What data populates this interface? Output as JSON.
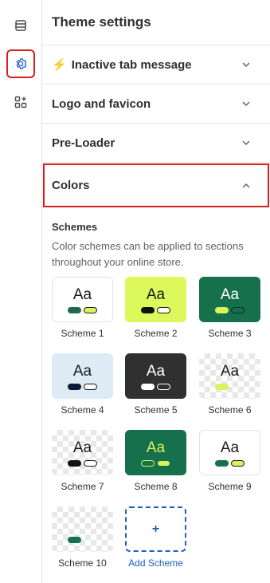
{
  "rail": {
    "items": [
      {
        "name": "sections-icon"
      },
      {
        "name": "theme-settings-icon",
        "active": true
      },
      {
        "name": "app-embeds-icon"
      }
    ],
    "accent": "#1f5fbf",
    "highlight": "#d61f1f"
  },
  "panel": {
    "title": "Theme settings",
    "accordions": [
      {
        "emoji": "⚡",
        "label": "Inactive tab message",
        "state": "collapsed"
      },
      {
        "label": "Logo and favicon",
        "state": "collapsed"
      },
      {
        "label": "Pre-Loader",
        "state": "collapsed"
      },
      {
        "label": "Colors",
        "state": "expanded"
      }
    ],
    "colors": {
      "schemes_heading": "Schemes",
      "description": "Color schemes can be applied to sections throughout your online store.",
      "schemes": [
        {
          "label": "Scheme 1",
          "text": "Aa",
          "bg": "#ffffff",
          "fg": "#1a1a1a",
          "pill1": "#1b6b4b",
          "pill2": "#d7f55a",
          "border": "#e3e3e3"
        },
        {
          "label": "Scheme 2",
          "text": "Aa",
          "bg": "#dcf85a",
          "fg": "#1a1a1a",
          "pill1": "#111111",
          "pill2": "#ffffff"
        },
        {
          "label": "Scheme 3",
          "text": "Aa",
          "bg": "#17704c",
          "fg": "#ffffff",
          "pill1": "#d7f55a",
          "pill2": "#17704c"
        },
        {
          "label": "Scheme 4",
          "text": "Aa",
          "bg": "#deebf5",
          "fg": "#1a1a1a",
          "pill1": "#0b1a3a",
          "pill2": "#ffffff"
        },
        {
          "label": "Scheme 5",
          "text": "Aa",
          "bg": "#303030",
          "fg": "#ffffff",
          "pill1": "#ffffff",
          "pill2": "#303030"
        },
        {
          "label": "Scheme 6",
          "text": "Aa",
          "bg": "checker",
          "fg": "#1a1a1a",
          "pill1": "#d7f55a",
          "pill2": null
        },
        {
          "label": "Scheme 7",
          "text": "Aa",
          "bg": "checker",
          "fg": "#1a1a1a",
          "pill1": "#111111",
          "pill2": "#ffffff"
        },
        {
          "label": "Scheme 8",
          "text": "Aa",
          "bg": "#17704c",
          "fg": "#d7f55a",
          "pill1": "#17704c",
          "pill2": "#d7f55a"
        },
        {
          "label": "Scheme 9",
          "text": "Aa",
          "bg": "#ffffff",
          "fg": "#1a1a1a",
          "pill1": "#17704c",
          "pill2": "#d7f55a",
          "border": "#e3e3e3"
        },
        {
          "label": "Scheme 10",
          "text": "",
          "bg": "checker",
          "fg": "#1a1a1a",
          "pill1": "#17704c",
          "pill2": null
        }
      ],
      "add_label": "Add Scheme",
      "add_icon": "+"
    }
  }
}
